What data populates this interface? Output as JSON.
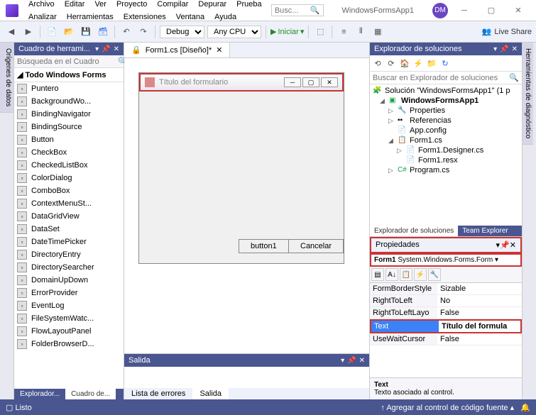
{
  "menubar": [
    "Archivo",
    "Editar",
    "Ver",
    "Proyecto",
    "Compilar",
    "Depurar",
    "Prueba",
    "Analizar",
    "Herramientas",
    "Extensiones",
    "Ventana",
    "Ayuda"
  ],
  "search_placeholder": "Busc...",
  "app_title": "WindowsFormsApp1",
  "avatar": "DM",
  "toolbar": {
    "config": "Debug",
    "platform": "Any CPU",
    "start": "Iniciar"
  },
  "liveshare": "Live Share",
  "toolbox": {
    "title": "Cuadro de herrami...",
    "search": "Búsqueda en el Cuadro",
    "group": "Todo Windows Forms",
    "items": [
      "Puntero",
      "BackgroundWo...",
      "BindingNavigator",
      "BindingSource",
      "Button",
      "CheckBox",
      "CheckedListBox",
      "ColorDialog",
      "ComboBox",
      "ContextMenuSt...",
      "DataGridView",
      "DataSet",
      "DateTimePicker",
      "DirectoryEntry",
      "DirectorySearcher",
      "DomainUpDown",
      "ErrorProvider",
      "EventLog",
      "FileSystemWatc...",
      "FlowLayoutPanel",
      "FolderBrowserD..."
    ],
    "tabs": [
      "Explorador...",
      "Cuadro de..."
    ]
  },
  "doc_tab": "Form1.cs [Diseño]*",
  "form": {
    "title": "Título del formulario",
    "button1": "button1",
    "cancel": "Cancelar"
  },
  "output": {
    "title": "Salida",
    "tabs": [
      "Lista de errores",
      "Salida"
    ]
  },
  "solution": {
    "title": "Explorador de soluciones",
    "search": "Buscar en Explorador de soluciones",
    "root": "Solución \"WindowsFormsApp1\" (1 p",
    "project": "WindowsFormsApp1",
    "nodes": {
      "properties": "Properties",
      "references": "Referencias",
      "appconfig": "App.config",
      "form1": "Form1.cs",
      "designer": "Form1.Designer.cs",
      "resx": "Form1.resx",
      "program": "Program.cs"
    },
    "tabs": [
      "Explorador de soluciones",
      "Team Explorer"
    ]
  },
  "props": {
    "title": "Propiedades",
    "object": "Form1",
    "type": "System.Windows.Forms.Form",
    "rows": [
      {
        "name": "FormBorderStyle",
        "val": "Sizable"
      },
      {
        "name": "RightToLeft",
        "val": "No"
      },
      {
        "name": "RightToLeftLayo",
        "val": "False"
      },
      {
        "name": "Text",
        "val": "Título del formula"
      },
      {
        "name": "UseWaitCursor",
        "val": "False"
      }
    ],
    "desc_name": "Text",
    "desc_text": "Texto asociado al control."
  },
  "status": {
    "ready": "Listo",
    "add": "Agregar al control de código fuente"
  }
}
